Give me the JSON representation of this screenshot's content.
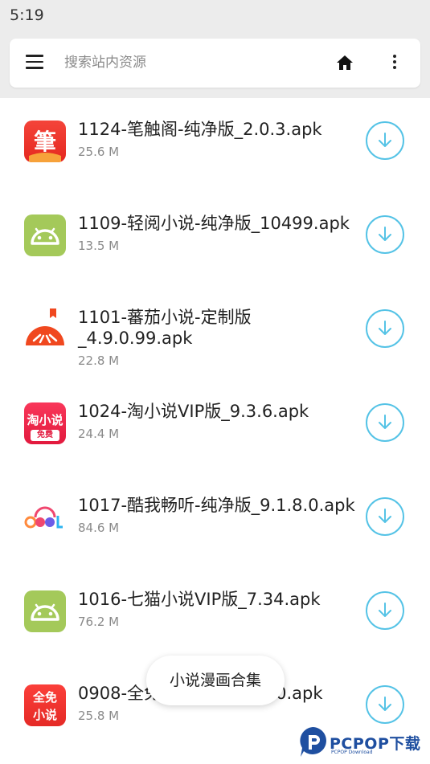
{
  "status_bar": {
    "time": "5:19"
  },
  "search": {
    "placeholder": "搜索站内资源"
  },
  "icons": {
    "menu": "menu-icon",
    "home": "home-icon",
    "more": "more-vert-icon",
    "download": "download-icon"
  },
  "colors": {
    "accent": "#55c3e6",
    "background_top": "#ececec"
  },
  "files": [
    {
      "title": "1124-笔触阁-纯净版_2.0.3.apk",
      "size": "25.6 M",
      "icon": "bichuge-app-icon"
    },
    {
      "title": "1109-轻阅小说-纯净版_10499.apk",
      "size": "13.5 M",
      "icon": "android-app-icon"
    },
    {
      "title": "1101-蕃茄小说-定制版_4.9.0.99.apk",
      "size": "22.8 M",
      "icon": "fanqie-app-icon"
    },
    {
      "title": "1024-淘小说VIP版_9.3.6.apk",
      "size": "24.4 M",
      "icon": "taoxiaoshuo-app-icon",
      "icon_text": "淘小说",
      "icon_sub": "免费"
    },
    {
      "title": "1017-酷我畅听-纯净版_9.1.8.0.apk",
      "size": "84.6 M",
      "icon": "kuwo-app-icon"
    },
    {
      "title": "1016-七猫小说VIP版_7.34.apk",
      "size": "76.2 M",
      "icon": "android-app-icon"
    },
    {
      "title": "0908-全免小说-纯净版_7.0.apk",
      "size": "25.8 M",
      "icon": "quanmian-app-icon",
      "icon_text_top": "全免",
      "icon_text_bottom": "小说"
    }
  ],
  "toast": {
    "text": "小说漫画合集"
  },
  "watermark": {
    "brand": "PCPOP下载",
    "sub": "PCPOP Download"
  }
}
